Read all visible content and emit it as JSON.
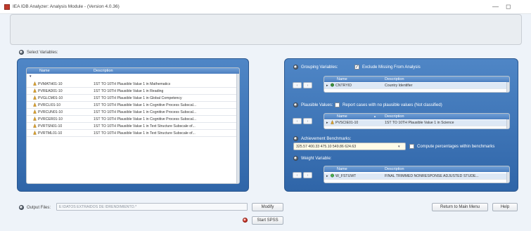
{
  "window": {
    "title": "IEA IDB Analyzer: Analysis Module - (Version 4.0.36)",
    "minimize_glyph": "—",
    "maximize_glyph": "◻"
  },
  "select_variables": {
    "label": "Select Variables:",
    "columns": [
      "Name",
      "Description"
    ],
    "filter_marker": "▼",
    "rows": [
      {
        "name": "PVMATH01-10",
        "description": "1ST TO 10TH Plausible Value 1 in Mathematics"
      },
      {
        "name": "PVREAD01-10",
        "description": "1ST TO 10TH Plausible Value 1 in Reading"
      },
      {
        "name": "PVGLCM01-10",
        "description": "1ST TO 10TH Plausible Value 1 in Global Competency"
      },
      {
        "name": "PVRCLI01-10",
        "description": "1ST TO 10TH Plausible Value 1 in Cognitive Process Subscal..."
      },
      {
        "name": "PVRCUN01-10",
        "description": "1ST TO 10TH Plausible Value 1 in Cognitive Process Subscal..."
      },
      {
        "name": "PVRCER01-10",
        "description": "1ST TO 10TH Plausible Value 1 in Cognitive Process Subscal..."
      },
      {
        "name": "PVRTSN01-10",
        "description": "1ST TO 10TH Plausible Value 1 in Text Structure Subscale of..."
      },
      {
        "name": "PVRTML01-10",
        "description": "1ST TO 10TH Plausible Value 1 in Text Structure Subscale of..."
      }
    ]
  },
  "grouping": {
    "label": "Grouping Variables:",
    "exclude_label": "Exclude Missing From Analysis",
    "exclude_checked": true,
    "columns": [
      "Name",
      "Description"
    ],
    "row": {
      "name": "CNTRYID",
      "description": "Country Identifier"
    }
  },
  "plausible": {
    "label": "Plausible Values:",
    "report_label": "Report cases with no plausible values (Not classified)",
    "columns": [
      "Name",
      "Description"
    ],
    "sort_glyph": "▲",
    "row": {
      "name": "PVSCIE01-10",
      "description": "1ST TO 10TH Plausible Value 1 in Science"
    }
  },
  "achievement": {
    "label": "Achievement Benchmarks:",
    "value": "325.57 400.33 475.10 549.86 624.63",
    "compute_label": "Compute percentages within benchmarks"
  },
  "weight": {
    "label": "Weight Variable:",
    "columns": [
      "Name",
      "Description"
    ],
    "row": {
      "name": "W_FSTUWT",
      "description": "FINAL TRIMMED NONRESPONSE ADJUSTED STUDE..."
    }
  },
  "arrows": {
    "left": "‹",
    "right": "›"
  },
  "output": {
    "label": "Output Files:",
    "value": "E:\\DATOS EXTRAIDOS DE IDRENDIMIENTO.*",
    "modify_label": "Modify",
    "start_label": "Start SPSS"
  },
  "footer": {
    "return_label": "Return to Main Menu",
    "help_label": "Help"
  },
  "colors": {
    "panel_blue": "#3a70b4",
    "header_blue": "#5b8fcf",
    "start_red": "#d53b2e"
  }
}
